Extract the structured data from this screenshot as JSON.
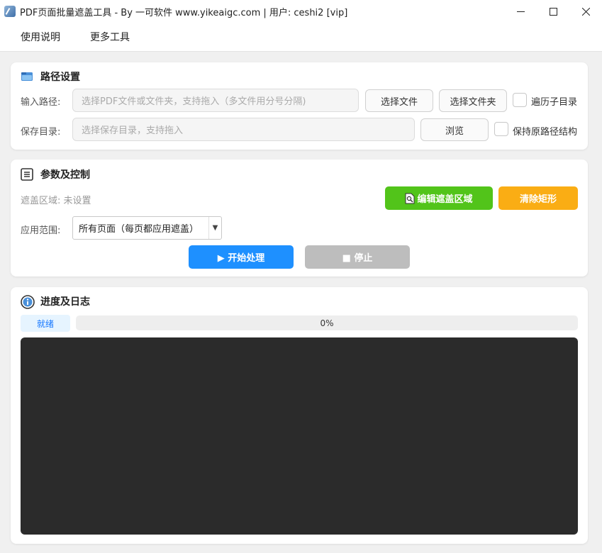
{
  "window": {
    "title": "PDF页面批量遮盖工具 - By 一可软件 www.yikeaigc.com  |  用户: ceshi2 [vip]"
  },
  "menu": [
    {
      "label": "使用说明"
    },
    {
      "label": "更多工具"
    }
  ],
  "path_section": {
    "title": "路径设置",
    "input_label": "输入路径:",
    "input_placeholder": "选择PDF文件或文件夹，支持拖入（多文件用分号分隔)",
    "select_file_button": "选择文件",
    "select_folder_button": "选择文件夹",
    "recurse_label": "遍历子目录",
    "recurse_checked": false,
    "save_label": "保存目录:",
    "save_placeholder": "选择保存目录，支持拖入",
    "browse_button": "浏览",
    "keep_structure_label": "保持原路径结构",
    "keep_structure_checked": false
  },
  "params_section": {
    "title": "参数及控制",
    "mask_area_text": "遮盖区域: 未设置",
    "edit_mask_button": "编辑遮盖区域",
    "clear_rect_button": "清除矩形",
    "scope_label": "应用范围:",
    "scope_value": "所有页面（每页都应用遮盖）",
    "start_button": "▶ 开始处理",
    "stop_button": "■ 停止"
  },
  "log_section": {
    "title": "进度及日志",
    "status": "就绪",
    "progress_value": 0,
    "progress_text": "0%"
  },
  "colors": {
    "green": "#52c41a",
    "orange": "#faad14",
    "blue": "#1e90ff",
    "disabled": "#bdbdbd",
    "log_bg": "#2b2b2b"
  }
}
